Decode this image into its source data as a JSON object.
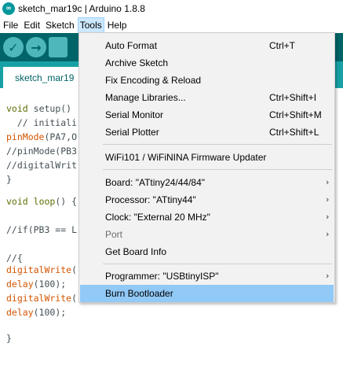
{
  "window": {
    "title": "sketch_mar19c | Arduino 1.8.8"
  },
  "menubar": {
    "file": "File",
    "edit": "Edit",
    "sketch": "Sketch",
    "tools": "Tools",
    "help": "Help"
  },
  "tab": {
    "label": "sketch_mar19"
  },
  "code": [
    "void setup()",
    "  // initiali",
    "pinMode(PA7,O",
    "//pinMode(PB3",
    "//digitalWrit",
    "}",
    "",
    "void loop() {",
    "",
    "//if(PB3 == L",
    "",
    "//{",
    "digitalWrite(",
    "delay(100);",
    "digitalWrite(",
    "delay(100);",
    "",
    "",
    "}"
  ],
  "tools_menu": {
    "auto_format": "Auto Format",
    "auto_format_shortcut": "Ctrl+T",
    "archive_sketch": "Archive Sketch",
    "fix_encoding": "Fix Encoding & Reload",
    "manage_libraries": "Manage Libraries...",
    "manage_libraries_shortcut": "Ctrl+Shift+I",
    "serial_monitor": "Serial Monitor",
    "serial_monitor_shortcut": "Ctrl+Shift+M",
    "serial_plotter": "Serial Plotter",
    "serial_plotter_shortcut": "Ctrl+Shift+L",
    "wifi_updater": "WiFi101 / WiFiNINA Firmware Updater",
    "board": "Board: \"ATtiny24/44/84\"",
    "processor": "Processor: \"ATtiny44\"",
    "clock": "Clock: \"External 20 MHz\"",
    "port": "Port",
    "get_board_info": "Get Board Info",
    "programmer": "Programmer: \"USBtinyISP\"",
    "burn_bootloader": "Burn Bootloader"
  },
  "colors": {
    "toolbar": "#006468",
    "tabstrip": "#17a1a5",
    "highlight": "#91c9f7",
    "keyword": "#5e6d03",
    "function": "#d35400"
  }
}
